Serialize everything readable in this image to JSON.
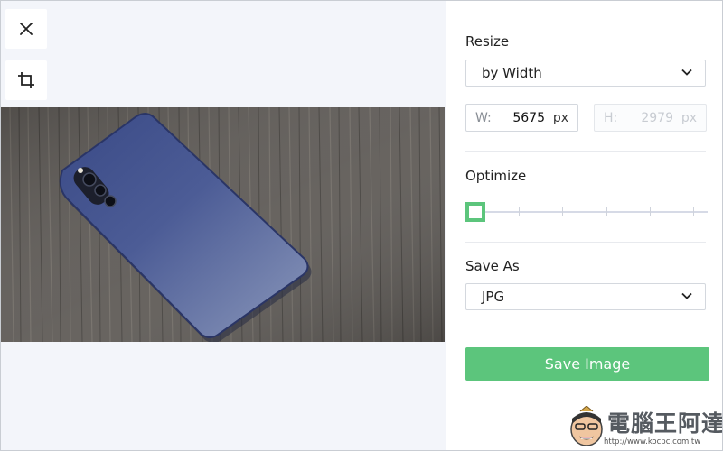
{
  "toolbar": {
    "close_icon": "close-icon",
    "crop_icon": "crop-icon"
  },
  "canvas": {
    "background": "#f3f5fa",
    "image_description_icon": "photo"
  },
  "panel": {
    "resize": {
      "label": "Resize",
      "mode_selected": "by Width",
      "width_prefix": "W:",
      "width_value": "5675",
      "width_unit": "px",
      "height_prefix": "H:",
      "height_value": "2979",
      "height_unit": "px"
    },
    "optimize": {
      "label": "Optimize",
      "level": 0,
      "steps": 5
    },
    "save_as": {
      "label": "Save As",
      "format_selected": "JPG"
    },
    "save_button": {
      "label": "Save Image"
    }
  },
  "watermark": {
    "title": "電腦王阿達",
    "url": "http://www.kocpc.com.tw"
  },
  "colors": {
    "accent": "#5cc57c",
    "panel_bg": "#ffffff",
    "canvas_bg": "#f3f5fa"
  }
}
